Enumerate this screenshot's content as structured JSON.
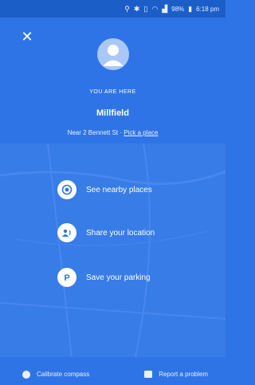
{
  "status_bar": {
    "icons": [
      "location-icon",
      "bluetooth-icon",
      "vibrate-icon",
      "wifi-icon",
      "signal-icon",
      "battery-icon"
    ],
    "battery": "98%",
    "time": "6:18 pm"
  },
  "header": {
    "eyebrow": "YOU ARE HERE",
    "place_name": "Millfield",
    "address": "Near 2 Bennett St ·",
    "pick_place_label": "Pick a place"
  },
  "actions": [
    {
      "label": "See nearby places",
      "icon": "nearby-target-icon"
    },
    {
      "label": "Share your location",
      "icon": "share-location-icon"
    },
    {
      "label": "Save your parking",
      "icon": "parking-icon"
    }
  ],
  "footer": {
    "calibrate_label": "Calibrate compass",
    "report_label": "Report a problem"
  },
  "colors": {
    "background": "#2f74e6",
    "status_bar": "#1c5ec8",
    "accent": "#ffffff"
  }
}
